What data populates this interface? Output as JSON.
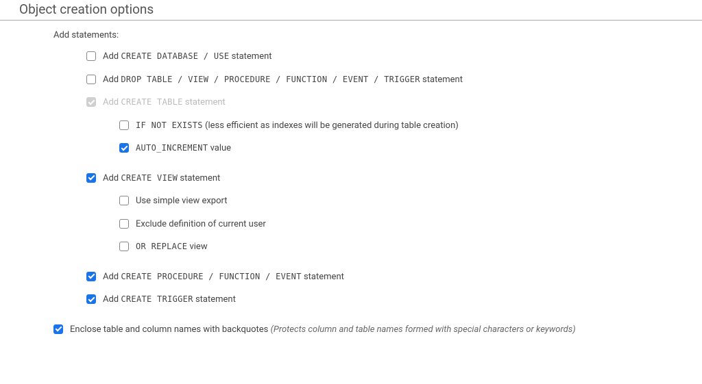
{
  "section": {
    "title": "Object creation options",
    "group_label": "Add statements:"
  },
  "options": {
    "create_database": {
      "checked": false,
      "prefix": "Add ",
      "mono": "CREATE DATABASE / USE",
      "suffix": " statement"
    },
    "drop_table": {
      "checked": false,
      "prefix": "Add ",
      "mono": "DROP TABLE / VIEW / PROCEDURE / FUNCTION / EVENT / TRIGGER",
      "suffix": " statement"
    },
    "create_table": {
      "checked": true,
      "disabled": true,
      "prefix": "Add ",
      "mono": "CREATE TABLE",
      "suffix": " statement"
    },
    "if_not_exists": {
      "checked": false,
      "mono": "IF NOT EXISTS",
      "suffix": " (less efficient as indexes will be generated during table creation)"
    },
    "auto_increment": {
      "checked": true,
      "mono": "AUTO_INCREMENT",
      "suffix": " value"
    },
    "create_view": {
      "checked": true,
      "prefix": "Add ",
      "mono": "CREATE VIEW",
      "suffix": " statement"
    },
    "simple_view": {
      "checked": false,
      "text": "Use simple view export"
    },
    "exclude_definition": {
      "checked": false,
      "text": "Exclude definition of current user"
    },
    "or_replace": {
      "checked": false,
      "mono": "OR REPLACE",
      "suffix": " view"
    },
    "create_procedure": {
      "checked": true,
      "prefix": "Add ",
      "mono": "CREATE PROCEDURE / FUNCTION / EVENT",
      "suffix": " statement"
    },
    "create_trigger": {
      "checked": true,
      "prefix": "Add ",
      "mono": "CREATE TRIGGER",
      "suffix": " statement"
    },
    "backquotes": {
      "checked": true,
      "text": "Enclose table and column names with backquotes ",
      "hint": "(Protects column and table names formed with special characters or keywords)"
    }
  }
}
